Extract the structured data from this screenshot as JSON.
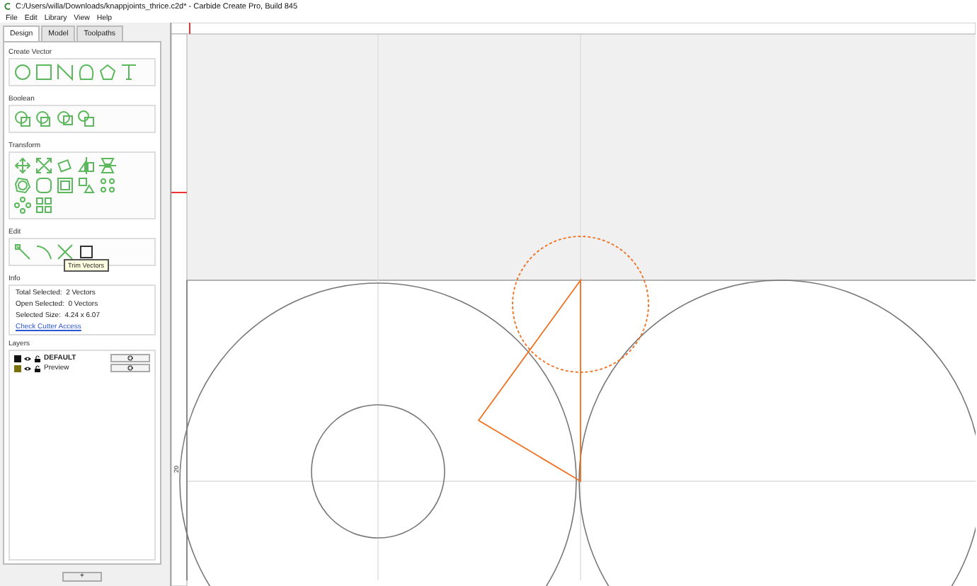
{
  "window": {
    "title": "C:/Users/willa/Downloads/knappjoints_thrice.c2d* - Carbide Create Pro, Build 845"
  },
  "menu": [
    "File",
    "Edit",
    "Library",
    "View",
    "Help"
  ],
  "tabs": [
    {
      "label": "Design",
      "selected": true
    },
    {
      "label": "Model",
      "selected": false
    },
    {
      "label": "Toolpaths",
      "selected": false
    }
  ],
  "sections": [
    {
      "title": "Create Vector"
    },
    {
      "title": "Boolean"
    },
    {
      "title": "Transform"
    },
    {
      "title": "Edit"
    }
  ],
  "tooltip": "Trim Vectors",
  "info": {
    "title": "Info",
    "lines": [
      "Total Selected:  2 Vectors",
      "Open Selected:  0 Vectors",
      "Selected Size:  4.24 x 6.07"
    ],
    "link": "Check Cutter Access"
  },
  "layers": {
    "title": "Layers",
    "items": [
      {
        "name": "DEFAULT",
        "color": "#111111",
        "active": true
      },
      {
        "name": "Preview",
        "color": "#7a7010",
        "active": false
      }
    ],
    "add_button": "+"
  },
  "ruler": {
    "left_label": "20"
  }
}
